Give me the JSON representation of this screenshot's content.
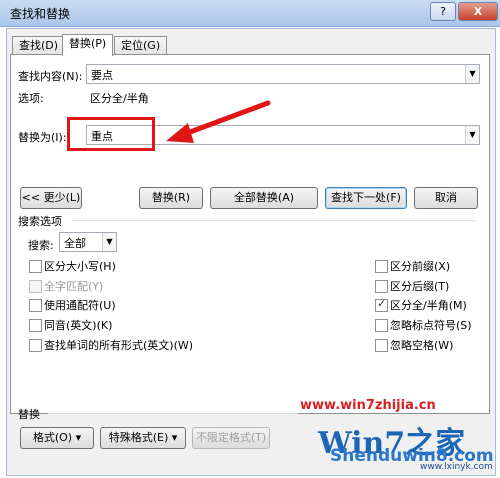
{
  "window": {
    "title": "查找和替换",
    "help": "?",
    "close": "X"
  },
  "tabs": [
    {
      "label": "查找(D)",
      "active": false
    },
    {
      "label": "替换(P)",
      "active": true
    },
    {
      "label": "定位(G)",
      "active": false
    }
  ],
  "find": {
    "label": "查找内容(N):",
    "value": "要点"
  },
  "options": {
    "label": "选项:",
    "value": "区分全/半角"
  },
  "replace": {
    "label": "替换为(I):",
    "value": "重点"
  },
  "buttons": {
    "less": "<< 更少(L)",
    "replace": "替换(R)",
    "replace_all": "全部替换(A)",
    "find_next": "查找下一处(F)",
    "cancel": "取消"
  },
  "search_options": {
    "heading": "搜索选项",
    "search_label": "搜索:",
    "search_value": "全部",
    "left": [
      {
        "label": "区分大小写(H)",
        "checked": false,
        "enabled": true
      },
      {
        "label": "全字匹配(Y)",
        "checked": false,
        "enabled": false
      },
      {
        "label": "使用通配符(U)",
        "checked": false,
        "enabled": true
      },
      {
        "label": "同音(英文)(K)",
        "checked": false,
        "enabled": true
      },
      {
        "label": "查找单词的所有形式(英文)(W)",
        "checked": false,
        "enabled": true
      }
    ],
    "right": [
      {
        "label": "区分前缀(X)",
        "checked": false,
        "enabled": true
      },
      {
        "label": "区分后缀(T)",
        "checked": false,
        "enabled": true
      },
      {
        "label": "区分全/半角(M)",
        "checked": true,
        "enabled": true
      },
      {
        "label": "忽略标点符号(S)",
        "checked": false,
        "enabled": true
      },
      {
        "label": "忽略空格(W)",
        "checked": false,
        "enabled": true
      }
    ]
  },
  "replace_section": {
    "heading": "替换",
    "format": "格式(O) ▾",
    "special": "特殊格式(E) ▾",
    "no_format": "不限定格式(T)"
  },
  "watermark": {
    "url": "www.win7zhijia.cn",
    "logo": "Win7之家",
    "sub": "Shenduwin8.com",
    "site": "www.lxinyk.com"
  },
  "colors": {
    "annotation": "#e01616",
    "title_bar": "#b9d1ee",
    "checkmark": "#1f3f7a"
  }
}
